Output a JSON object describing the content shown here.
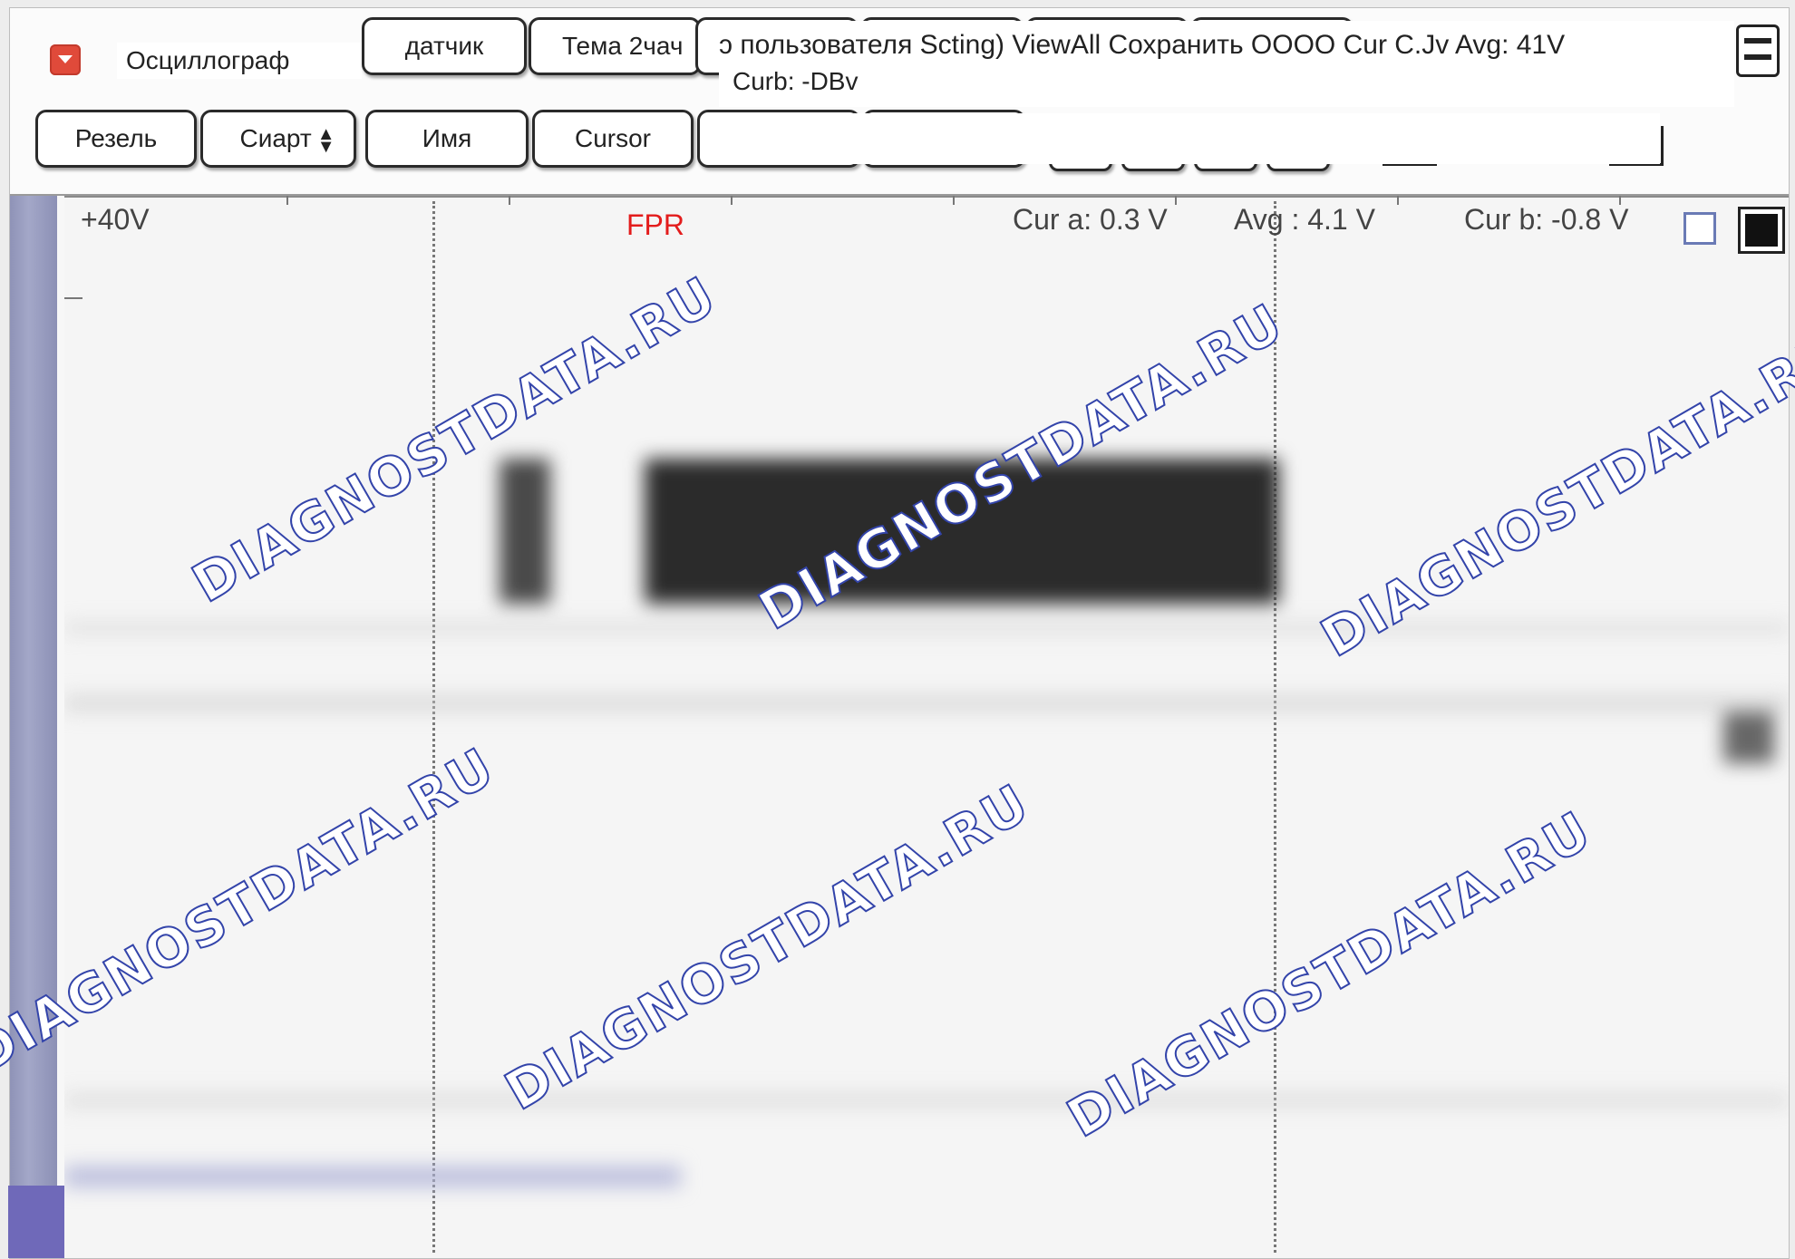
{
  "toolbar": {
    "app_title": "Осциллограф",
    "row1": {
      "sensor_label": "датчик",
      "theme_label": "Тема 2чач"
    },
    "row2": {
      "reset_label": "Резель",
      "start_label": "Сиарт",
      "name_label": "Имя",
      "cursor_label": "Cursor"
    },
    "overlay_line1": "ɔ пользователя Scting) ViewAll Сохранить OOOO Cur C.Jv Avg: 41V",
    "overlay_line2": "Curb: -DBv"
  },
  "scope": {
    "scale_label": "+40V",
    "channel_label": "FPR",
    "cur_a": "Cur a: 0.3 V",
    "avg": "Avg  : 4.1 V",
    "cur_b": "Cur b: -0.8 V"
  },
  "watermark": {
    "text": "DIAGNOSTDATA.RU",
    "color": "#3344aa"
  },
  "colors": {
    "channel": "#e31c1c",
    "app_icon": "#e04a3a",
    "left_strip": "#9a9ec0"
  },
  "icons": {
    "app": "dropdown-arrow-icon",
    "panel": "panel-menu-icon"
  }
}
